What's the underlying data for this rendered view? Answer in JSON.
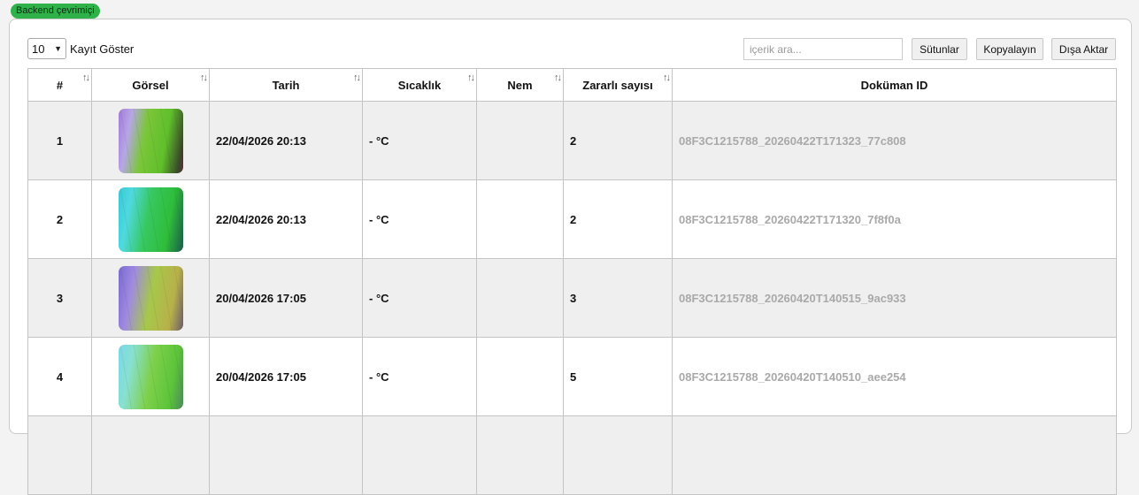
{
  "status_badge": "Backend çevrimiçi",
  "toolbar": {
    "page_length_value": "10",
    "page_length_label": "Kayıt Göster",
    "search_placeholder": "içerik ara...",
    "columns_button": "Sütunlar",
    "copy_button": "Kopyalayın",
    "export_button": "Dışa Aktar"
  },
  "table": {
    "headers": [
      "#",
      "Görsel",
      "Tarih",
      "Sıcaklık",
      "Nem",
      "Zararlı sayısı",
      "Doküman ID"
    ],
    "rows": [
      {
        "index": "1",
        "image": "thumbnail-purple-green",
        "date": "22/04/2026 20:13",
        "temperature": "- °C",
        "humidity": "",
        "pest_count": "2",
        "doc_id": "08F3C1215788_20260422T171323_77c808"
      },
      {
        "index": "2",
        "image": "thumbnail-cyan-green",
        "date": "22/04/2026 20:13",
        "temperature": "- °C",
        "humidity": "",
        "pest_count": "2",
        "doc_id": "08F3C1215788_20260422T171320_7f8f0a"
      },
      {
        "index": "3",
        "image": "thumbnail-violet-yellowgreen",
        "date": "20/04/2026 17:05",
        "temperature": "- °C",
        "humidity": "",
        "pest_count": "3",
        "doc_id": "08F3C1215788_20260420T140515_9ac933"
      },
      {
        "index": "4",
        "image": "thumbnail-lightcyan-green",
        "date": "20/04/2026 17:05",
        "temperature": "- °C",
        "humidity": "",
        "pest_count": "5",
        "doc_id": "08F3C1215788_20260420T140510_aee254"
      }
    ]
  },
  "colors": {
    "badge_bg": "#2fb24a",
    "row_stripe": "#efefef",
    "doc_id_text": "#a9a9a9"
  },
  "icons": {
    "sort": "sort-arrows-icon",
    "select_chevron": "chevron-down-icon"
  }
}
